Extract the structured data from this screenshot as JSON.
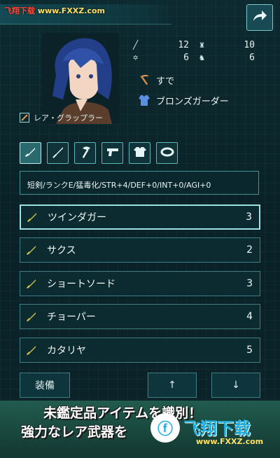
{
  "header": {
    "watermark_left": "飞翔下载",
    "watermark_right": "www.FXXZ.com",
    "title": "",
    "share_icon": "share-arrow-icon"
  },
  "character": {
    "stats": [
      {
        "icon": "sword-icon",
        "value": "12",
        "icon2": "armor-icon",
        "value2": "10"
      },
      {
        "icon": "star-icon",
        "value": "6",
        "icon2": "boot-icon",
        "value2": "6"
      }
    ],
    "equipped_weapon": "すで",
    "equipped_armor": "ブロンズガーダー",
    "skill": "レア・グラップラー"
  },
  "categories": [
    {
      "name": "dagger-icon",
      "active": true
    },
    {
      "name": "sword-icon",
      "active": false
    },
    {
      "name": "axe-icon",
      "active": false
    },
    {
      "name": "gun-icon",
      "active": false
    },
    {
      "name": "shirt-icon",
      "active": false
    },
    {
      "name": "ring-icon",
      "active": false
    }
  ],
  "description": "短剣/ランクE/猛毒化/STR+4/DEF+0/INT+0/AGI+0",
  "items": [
    {
      "name": "ツインダガー",
      "count": "3",
      "selected": true
    },
    {
      "name": "サクス",
      "count": "2",
      "selected": false
    },
    {
      "name": "ショートソード",
      "count": "3",
      "selected": false
    },
    {
      "name": "チョーパー",
      "count": "4",
      "selected": false
    },
    {
      "name": "カタリヤ",
      "count": "5",
      "selected": false
    }
  ],
  "buttons": {
    "equip": "装備",
    "up": "↑",
    "down": "↓"
  },
  "banner": {
    "line1": "未鑑定品アイテムを識別！",
    "line2": "強力なレア武器を",
    "watermark": "飞翔下载",
    "watermark_url": "www.FXXZ.com"
  },
  "colors": {
    "background": "#0b2328",
    "accent": "#9fe3e1",
    "item_icon": "#c9c24a"
  }
}
